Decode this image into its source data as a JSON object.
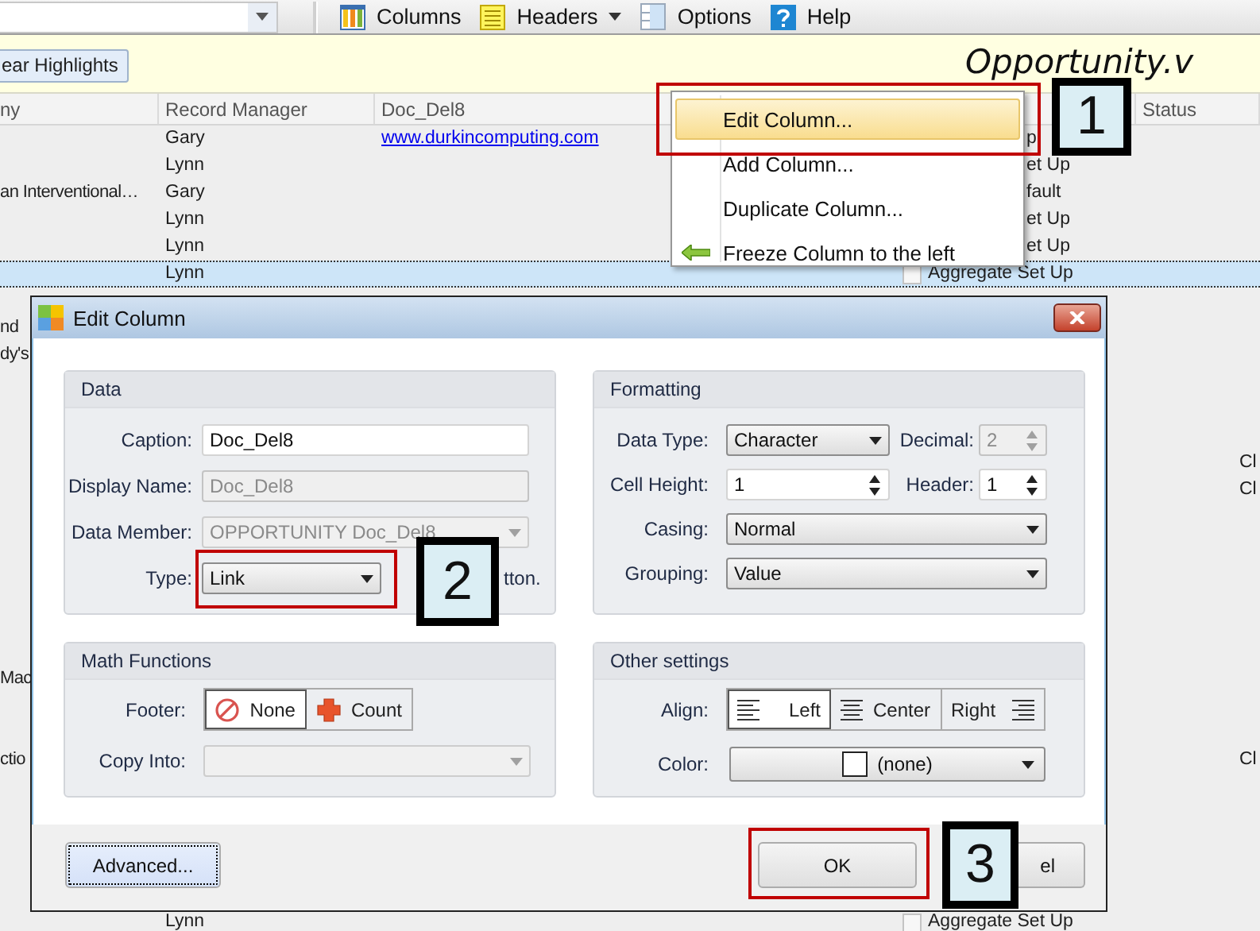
{
  "toolbar": {
    "items": [
      {
        "label": "Columns",
        "kind": "button"
      },
      {
        "label": "Headers",
        "kind": "dropdown"
      },
      {
        "label": "Options",
        "kind": "button"
      },
      {
        "label": "Help",
        "kind": "button"
      }
    ]
  },
  "highlight_bar": {
    "button": "ear Highlights",
    "title": "Opportunity.v"
  },
  "grid": {
    "columns": [
      {
        "label": "ny"
      },
      {
        "label": "Record Manager"
      },
      {
        "label": "Doc_Del8"
      },
      {},
      {
        "label": "Status"
      }
    ],
    "rows": [
      {
        "selected": false,
        "record_manager": "Gary",
        "doc_del8": "www.durkincomputing.com",
        "column_4": {
          "text": "p",
          "kind": "cut"
        }
      },
      {
        "selected": false,
        "record_manager": "Lynn",
        "column_4": {
          "text": "et Up",
          "kind": "cut"
        }
      },
      {
        "selected": false,
        "column_1": "an Interventional…",
        "record_manager": "Gary",
        "column_4": {
          "text": "fault",
          "kind": "cut"
        }
      },
      {
        "selected": false,
        "record_manager": "Lynn",
        "column_4": {
          "text": "et Up",
          "kind": "cut"
        }
      },
      {
        "selected": false,
        "record_manager": "Lynn",
        "column_4": {
          "text": "et Up",
          "kind": "cut"
        }
      },
      {
        "selected": true,
        "record_manager": "Lynn",
        "column_4": {
          "text": "Aggregate Set Up",
          "kind": "full",
          "checked": false
        }
      },
      {},
      {
        "selected": false,
        "column_1": "nd"
      },
      {
        "selected": false,
        "column_1": "dy's"
      },
      {},
      {},
      {},
      {
        "selected": false,
        "status": "Cl"
      },
      {
        "selected": false,
        "status": "Cl"
      },
      {},
      {},
      {},
      {},
      {},
      {},
      {
        "selected": false,
        "column_1": "Mac"
      },
      {},
      {},
      {
        "selected": false,
        "column_1": "ctio",
        "status": "Cl"
      },
      {},
      {},
      {},
      {},
      {},
      {
        "selected": false,
        "record_manager": "Lynn",
        "column_4": {
          "text": "Aggregate Set Up",
          "kind": "full",
          "checked": false
        }
      }
    ]
  },
  "context_menu": {
    "items": [
      {
        "label": "Edit Column...",
        "selected": true
      },
      {
        "label": "Add Column...",
        "selected": false
      },
      {
        "label": "Duplicate Column...",
        "selected": false
      },
      {
        "label": "Freeze Column to the left",
        "selected": false
      }
    ]
  },
  "dialog": {
    "title": "Edit Column",
    "data": {
      "title": "Data",
      "fields": [
        {
          "kind": "text",
          "label": "Caption:",
          "value": "Doc_Del8",
          "disabled": false
        },
        {
          "kind": "text",
          "label": "Display Name:",
          "value": "Doc_Del8",
          "disabled": true
        },
        {
          "kind": "combo",
          "label": "Data Member:",
          "value": "OPPORTUNITY Doc_Del8",
          "disabled": true
        },
        {
          "kind": "combo",
          "label": "Type:",
          "value": "Link",
          "disabled": false,
          "note": "tton."
        }
      ]
    },
    "formatting": {
      "title": "Formatting",
      "fields": [
        {
          "kind": "combo",
          "label": "Data Type:",
          "value": "Character",
          "disabled": false
        },
        {
          "kind": "spin",
          "label": "Decimal:",
          "value": "2",
          "disabled": true
        },
        {
          "kind": "spin",
          "label": "Cell Height:",
          "value": "1",
          "disabled": false
        },
        {
          "kind": "spin",
          "label": "Header:",
          "value": "1",
          "disabled": false
        },
        {
          "kind": "combo",
          "label": "Casing:",
          "value": "Normal",
          "disabled": false
        },
        {
          "kind": "combo",
          "label": "Grouping:",
          "value": "Value",
          "disabled": false
        }
      ]
    },
    "math_functions": {
      "title": "Math Functions",
      "footer": {
        "label": "Footer:",
        "options": [
          {
            "label": "None",
            "selected": true
          },
          {
            "label": "Count",
            "selected": false
          }
        ]
      },
      "copy_into": {
        "label": "Copy Into:",
        "disabled": true
      }
    },
    "other_settings": {
      "title": "Other settings",
      "align": {
        "label": "Align:",
        "options": [
          {
            "label": "Left",
            "selected": true
          },
          {
            "label": "Center",
            "selected": false
          },
          {
            "label": "Right",
            "selected": false
          }
        ]
      },
      "color": {
        "label": "Color:",
        "value": "(none)"
      }
    },
    "buttons": [
      {
        "label": "Advanced...",
        "focused": true
      },
      {
        "label": "OK",
        "focused": false
      },
      {
        "label": "el",
        "focused": false
      }
    ]
  },
  "annotations": [
    {
      "label": "1"
    },
    {
      "label": "2"
    },
    {
      "label": "3"
    }
  ]
}
